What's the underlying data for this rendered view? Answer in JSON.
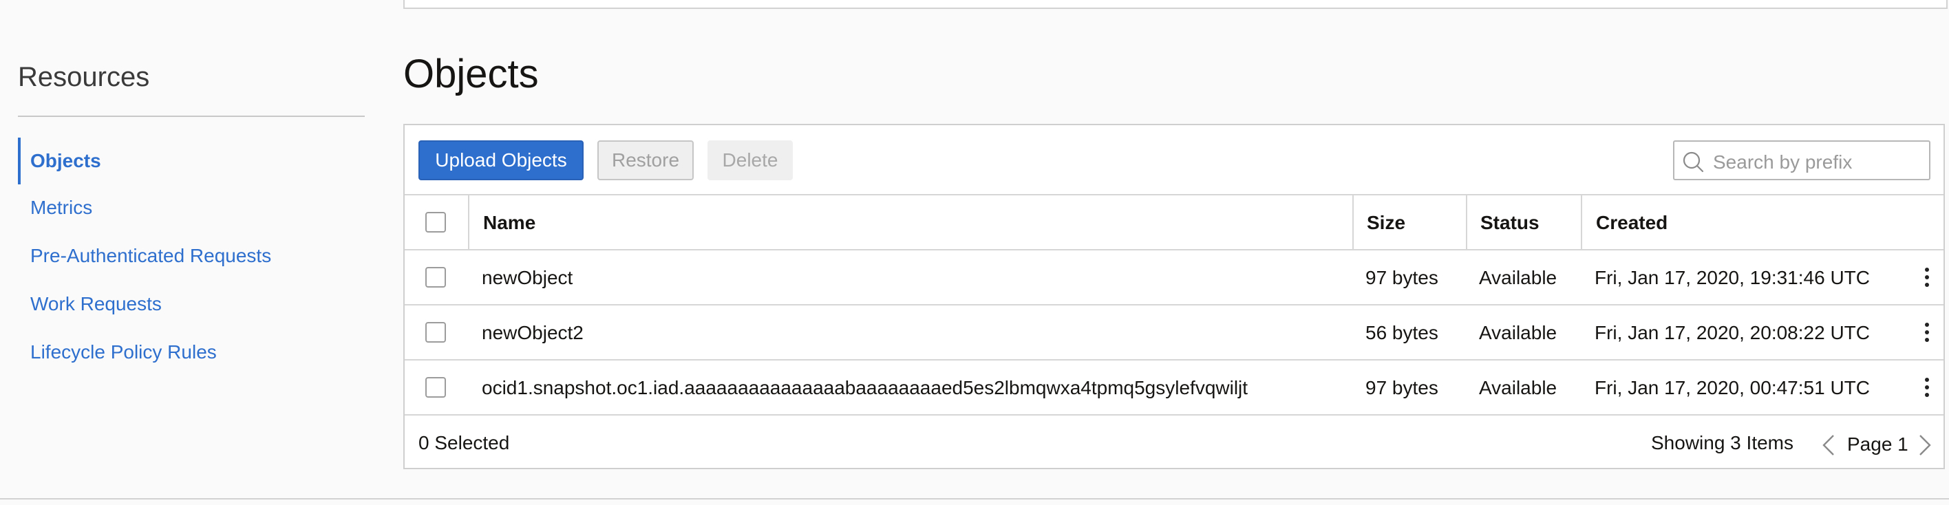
{
  "sidebar": {
    "title": "Resources",
    "items": [
      {
        "label": "Objects",
        "active": true
      },
      {
        "label": "Metrics"
      },
      {
        "label": "Pre-Authenticated Requests"
      },
      {
        "label": "Work Requests"
      },
      {
        "label": "Lifecycle Policy Rules"
      }
    ]
  },
  "main": {
    "title": "Objects",
    "toolbar": {
      "upload_label": "Upload Objects",
      "restore_label": "Restore",
      "delete_label": "Delete",
      "search_placeholder": "Search by prefix"
    },
    "table": {
      "columns": [
        "Name",
        "Size",
        "Status",
        "Created"
      ],
      "rows": [
        {
          "name": "newObject",
          "size": "97 bytes",
          "status": "Available",
          "created": "Fri, Jan 17, 2020, 19:31:46 UTC"
        },
        {
          "name": "newObject2",
          "size": "56 bytes",
          "status": "Available",
          "created": "Fri, Jan 17, 2020, 20:08:22 UTC"
        },
        {
          "name": "ocid1.snapshot.oc1.iad.aaaaaaaaaaaaaaabaaaaaaaaed5es2lbmqwxa4tpmq5gsylefvqwiljt",
          "size": "97 bytes",
          "status": "Available",
          "created": "Fri, Jan 17, 2020, 00:47:51 UTC"
        }
      ]
    },
    "footer": {
      "selected": "0 Selected",
      "showing": "Showing 3 Items",
      "page": "Page 1"
    }
  },
  "colors": {
    "accent": "#2e6fce",
    "border": "#d6d6d6",
    "disabled_text": "#a0a0a0"
  }
}
